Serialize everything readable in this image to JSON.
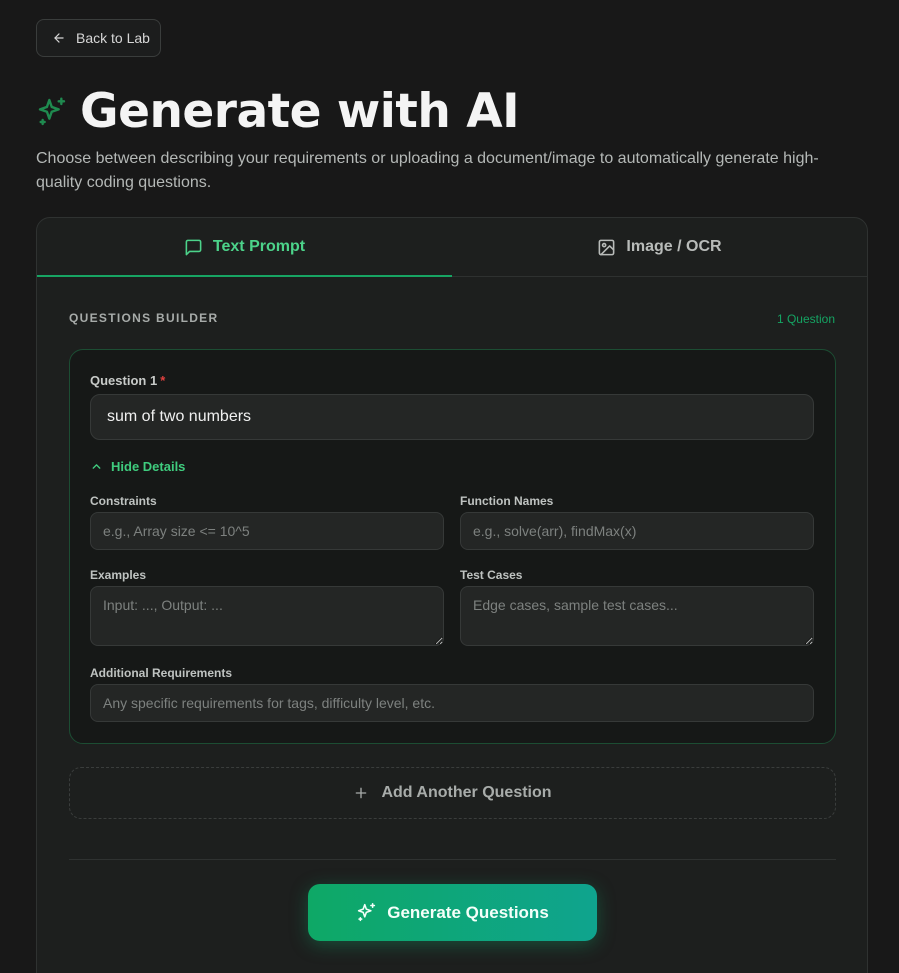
{
  "nav": {
    "back_label": "Back to Lab"
  },
  "header": {
    "title": "Generate with AI",
    "subtitle": "Choose between describing your requirements or uploading a document/image to automatically generate high-quality coding questions."
  },
  "tabs": [
    {
      "label": "Text Prompt",
      "active": true,
      "icon": "message-square-icon"
    },
    {
      "label": "Image / OCR",
      "active": false,
      "icon": "image-icon"
    }
  ],
  "builder": {
    "section_label": "QUESTIONS BUILDER",
    "count_label": "1 Question",
    "question": {
      "label": "Question 1",
      "required_mark": "*",
      "value": "sum of two numbers",
      "toggle_label": "Hide Details",
      "fields": {
        "constraints": {
          "label": "Constraints",
          "placeholder": "e.g., Array size <= 10^5"
        },
        "function_names": {
          "label": "Function Names",
          "placeholder": "e.g., solve(arr), findMax(x)"
        },
        "examples": {
          "label": "Examples",
          "placeholder": "Input: ..., Output: ..."
        },
        "test_cases": {
          "label": "Test Cases",
          "placeholder": "Edge cases, sample test cases..."
        },
        "additional": {
          "label": "Additional Requirements",
          "placeholder": "Any specific requirements for tags, difficulty level, etc."
        }
      }
    },
    "add_label": "Add Another Question"
  },
  "actions": {
    "generate_label": "Generate Questions"
  },
  "colors": {
    "accent": "#4cd38a",
    "accent_dark": "#17a463",
    "background": "#181818",
    "card": "#1d1f1e",
    "required": "#e0413f",
    "button_gradient_start": "#0ea866",
    "button_gradient_end": "#0fa48e"
  }
}
